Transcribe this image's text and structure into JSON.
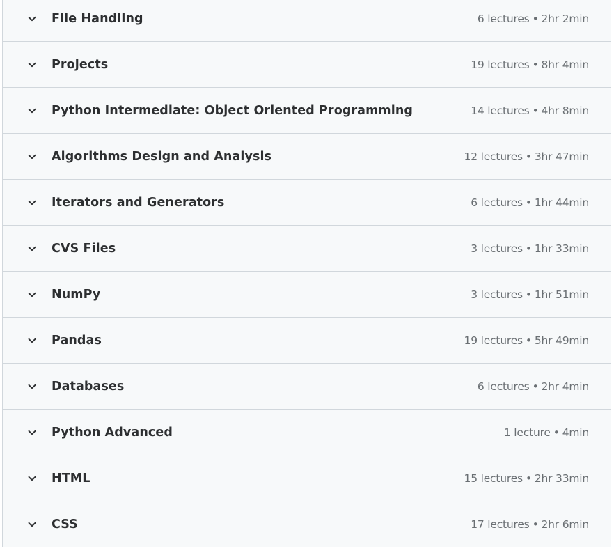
{
  "sections": [
    {
      "title": "File Handling",
      "lectures": "6 lectures",
      "duration": "2hr 2min"
    },
    {
      "title": "Projects",
      "lectures": "19 lectures",
      "duration": "8hr 4min"
    },
    {
      "title": "Python Intermediate: Object Oriented Programming",
      "lectures": "14 lectures",
      "duration": "4hr 8min"
    },
    {
      "title": "Algorithms Design and Analysis",
      "lectures": "12 lectures",
      "duration": "3hr 47min"
    },
    {
      "title": "Iterators and Generators",
      "lectures": "6 lectures",
      "duration": "1hr 44min"
    },
    {
      "title": "CVS Files",
      "lectures": "3 lectures",
      "duration": "1hr 33min"
    },
    {
      "title": "NumPy",
      "lectures": "3 lectures",
      "duration": "1hr 51min"
    },
    {
      "title": "Pandas",
      "lectures": "19 lectures",
      "duration": "5hr 49min"
    },
    {
      "title": "Databases",
      "lectures": "6 lectures",
      "duration": "2hr 4min"
    },
    {
      "title": "Python Advanced",
      "lectures": "1 lecture",
      "duration": "4min"
    },
    {
      "title": "HTML",
      "lectures": "15 lectures",
      "duration": "2hr 33min"
    },
    {
      "title": "CSS",
      "lectures": "17 lectures",
      "duration": "2hr 6min"
    }
  ],
  "separator": "•",
  "icons": {
    "expand": "chevron-down-icon"
  },
  "colors": {
    "row_background": "#f7f9fa",
    "border": "#d1d7dc",
    "title_text": "#2d2f31",
    "meta_text": "#6a6f73"
  }
}
